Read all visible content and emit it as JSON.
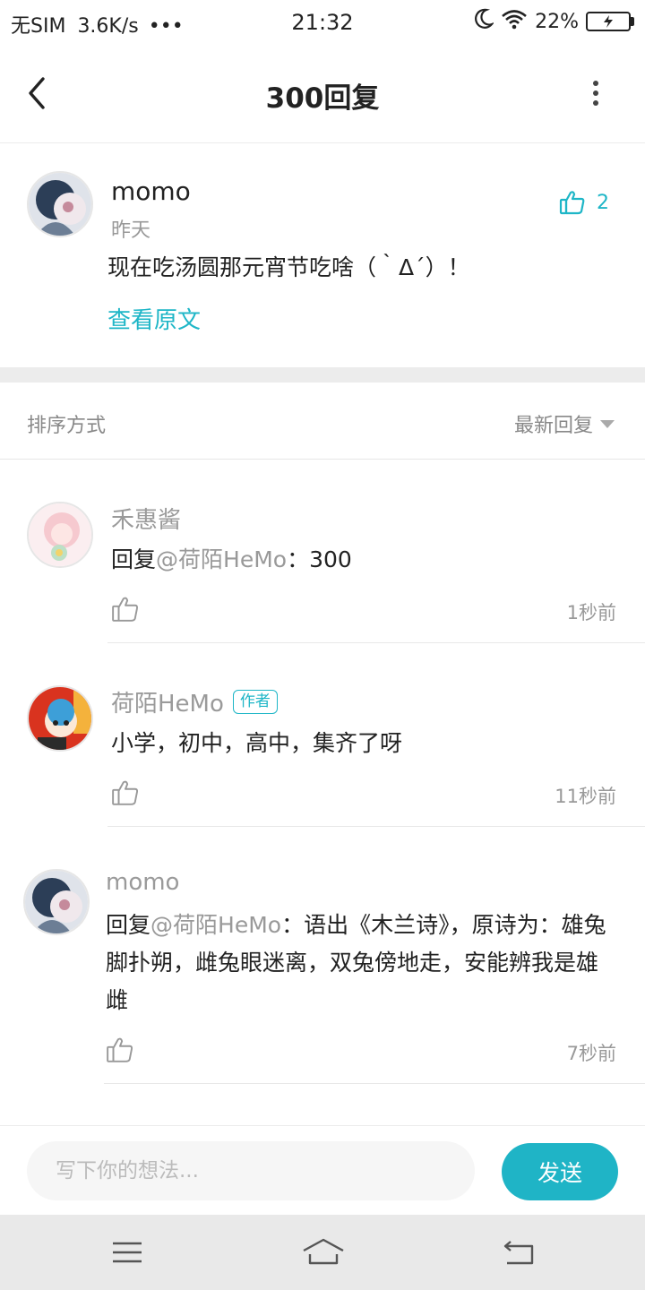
{
  "status_bar": {
    "carrier": "无SIM",
    "speed": "3.6K/s",
    "dots": "•••",
    "time": "21:32",
    "battery_percent": "22%"
  },
  "nav": {
    "title": "300回复",
    "icons": [
      "chevron-left-icon",
      "more-vertical-icon"
    ]
  },
  "post": {
    "author": "momo",
    "time": "昨天",
    "text": "现在吃汤圆那元宵节吃啥（｀Δ´）！",
    "view_original": "查看原文",
    "like_count": "2"
  },
  "sort": {
    "label": "排序方式",
    "value": "最新回复"
  },
  "replies": [
    {
      "author": "禾惠酱",
      "badge": "",
      "prefix": "回复",
      "mention": "@荷陌HeMo",
      "body": "：300",
      "time": "1秒前"
    },
    {
      "author": "荷陌HeMo",
      "badge": "作者",
      "prefix": "",
      "mention": "",
      "body": "小学，初中，高中，集齐了呀",
      "time": "11秒前"
    },
    {
      "author": "momo",
      "badge": "",
      "prefix": "回复",
      "mention": "@荷陌HeMo",
      "body": "：语出《木兰诗》，原诗为：雄兔脚扑朔，雌兔眼迷离，双兔傍地走，安能辨我是雄雌",
      "time": "7秒前"
    }
  ],
  "input": {
    "placeholder": "写下你的想法...",
    "value": "",
    "send_label": "发送"
  },
  "colors": {
    "accent": "#1eb6c7",
    "text": "#222222",
    "muted": "#999999",
    "divider": "#ececec"
  }
}
